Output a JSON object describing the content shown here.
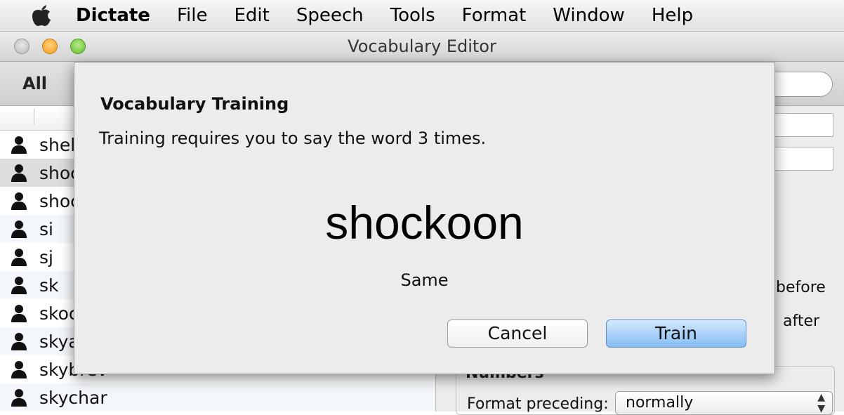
{
  "menubar": {
    "app_name": "Dictate",
    "items": [
      "File",
      "Edit",
      "Speech",
      "Tools",
      "Format",
      "Window",
      "Help"
    ]
  },
  "window": {
    "title": "Vocabulary Editor"
  },
  "toolbar": {
    "filter_all": "All"
  },
  "vocab_list": {
    "rows": [
      {
        "label": "shel"
      },
      {
        "label": "shoc",
        "selected": true
      },
      {
        "label": "shoc"
      },
      {
        "label": "si"
      },
      {
        "label": "sj"
      },
      {
        "label": "sk"
      },
      {
        "label": "skoc"
      },
      {
        "label": "skya"
      },
      {
        "label": "skybrev"
      },
      {
        "label": "skychar"
      }
    ]
  },
  "right_pane": {
    "before_label": "before",
    "after_label": "after",
    "section_label": "Numbers",
    "format_preceding_label": "Format preceding:",
    "format_preceding_value": "normally"
  },
  "dialog": {
    "title": "Vocabulary Training",
    "message": "Training requires you to say the word 3 times.",
    "word": "shockoon",
    "status": "Same",
    "cancel_label": "Cancel",
    "train_label": "Train"
  },
  "colors": {
    "train_button": "#84bdf4",
    "selected_row": "#dcdcdc",
    "close": "#c8c8c8",
    "minimize": "#f5a623",
    "zoom": "#6cc23a"
  },
  "icons": {
    "apple": "apple-logo-icon",
    "row": "user-icon",
    "select": "up-down-arrows-icon"
  }
}
